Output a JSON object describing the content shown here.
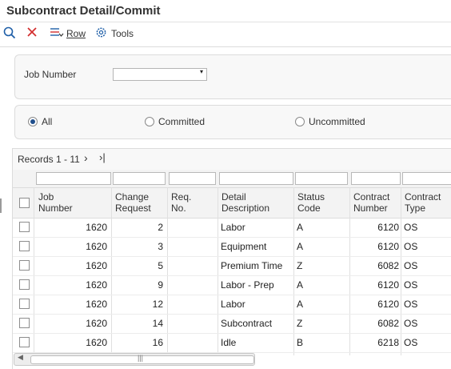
{
  "page": {
    "title": "Subcontract Detail/Commit"
  },
  "toolbar": {
    "row_label": "Row",
    "tools_label": "Tools"
  },
  "form": {
    "job_number_label": "Job Number",
    "job_number_value": ""
  },
  "filter": {
    "options": [
      "All",
      "Committed",
      "Uncommitted"
    ],
    "selected": "All"
  },
  "grid": {
    "records_label": "Records 1 - 11",
    "columns": [
      "Job\nNumber",
      "Change\nRequest",
      "Req.\nNo.",
      "Detail\nDescription",
      "Status\nCode",
      "Contract\nNumber",
      "Contract\nType"
    ],
    "rows": [
      {
        "job": "1620",
        "change": "2",
        "req": "",
        "desc": "Labor",
        "status": "A",
        "contract": "6120",
        "type": "OS"
      },
      {
        "job": "1620",
        "change": "3",
        "req": "",
        "desc": "Equipment",
        "status": "A",
        "contract": "6120",
        "type": "OS"
      },
      {
        "job": "1620",
        "change": "5",
        "req": "",
        "desc": "Premium Time",
        "status": "Z",
        "contract": "6082",
        "type": "OS"
      },
      {
        "job": "1620",
        "change": "9",
        "req": "",
        "desc": "Labor - Prep",
        "status": "A",
        "contract": "6120",
        "type": "OS"
      },
      {
        "job": "1620",
        "change": "12",
        "req": "",
        "desc": "Labor",
        "status": "A",
        "contract": "6120",
        "type": "OS"
      },
      {
        "job": "1620",
        "change": "14",
        "req": "",
        "desc": "Subcontract",
        "status": "Z",
        "contract": "6082",
        "type": "OS"
      },
      {
        "job": "1620",
        "change": "16",
        "req": "",
        "desc": "Idle",
        "status": "B",
        "contract": "6218",
        "type": "OS"
      }
    ]
  },
  "colors": {
    "accent": "#1f5fa8",
    "close": "#d32f2f"
  }
}
